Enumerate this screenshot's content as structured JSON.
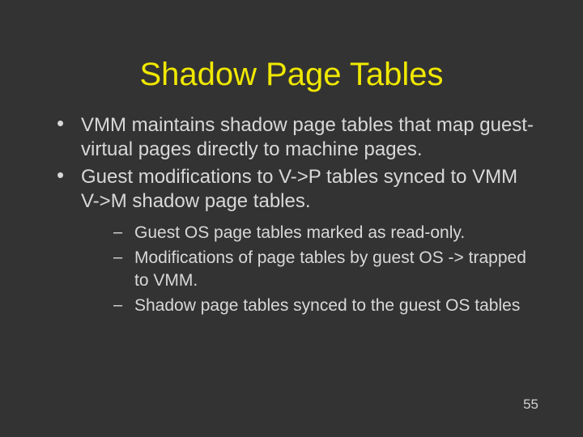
{
  "title": "Shadow Page Tables",
  "bullets": {
    "b0": "VMM maintains shadow page tables that map guest-virtual pages directly to machine pages.",
    "b1": "Guest modifications to V->P tables synced to VMM V->M shadow page tables."
  },
  "subbullets": {
    "s0": "Guest OS page tables marked as read-only.",
    "s1": "Modifications of page tables by guest OS -> trapped to VMM.",
    "s2": "Shadow page tables synced to the guest OS tables"
  },
  "page_number": "55"
}
